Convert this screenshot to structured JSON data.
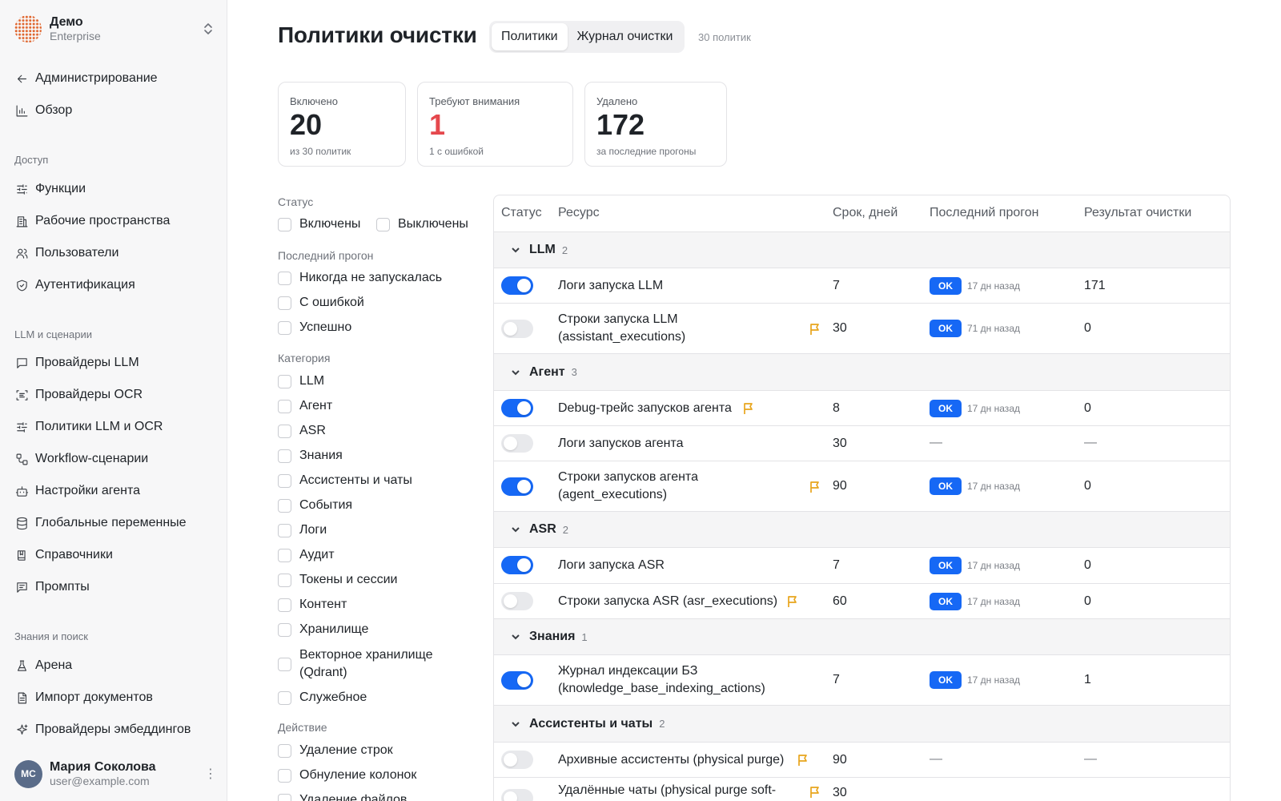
{
  "org": {
    "name": "Демо",
    "plan": "Enterprise"
  },
  "nav": {
    "back": "Администрирование",
    "overview": "Обзор",
    "sections": {
      "access": "Доступ",
      "llm": "LLM и сценарии",
      "knowledge": "Знания и поиск"
    },
    "access_items": [
      "Функции",
      "Рабочие пространства",
      "Пользователи",
      "Аутентификация"
    ],
    "llm_items": [
      "Провайдеры LLM",
      "Провайдеры OCR",
      "Политики LLM и OCR",
      "Workflow-сценарии",
      "Настройки агента",
      "Глобальные переменные",
      "Справочники",
      "Промпты"
    ],
    "knowledge_items": [
      "Арена",
      "Импорт документов",
      "Провайдеры эмбеддингов"
    ]
  },
  "user": {
    "initials": "МС",
    "name": "Мария Соколова",
    "email": "user@example.com"
  },
  "header": {
    "title": "Политики очистки",
    "tabs": [
      "Политики",
      "Журнал очистки"
    ],
    "count": "30 политик"
  },
  "kpis": [
    {
      "label": "Включено",
      "value": "20",
      "sub": "из 30 политик"
    },
    {
      "label": "Требуют внимания",
      "value": "1",
      "sub": "1 с ошибкой"
    },
    {
      "label": "Удалено",
      "value": "172",
      "sub": "за последние прогоны"
    }
  ],
  "filters": {
    "status": {
      "title": "Статус",
      "options": [
        "Включены",
        "Выключены"
      ]
    },
    "last_run": {
      "title": "Последний прогон",
      "options": [
        "Никогда не запускалась",
        "С ошибкой",
        "Успешно"
      ]
    },
    "category": {
      "title": "Категория",
      "options": [
        "LLM",
        "Агент",
        "ASR",
        "Знания",
        "Ассистенты и чаты",
        "События",
        "Логи",
        "Аудит",
        "Токены и сессии",
        "Контент",
        "Хранилище",
        "Векторное хранилище (Qdrant)",
        "Служебное"
      ]
    },
    "action": {
      "title": "Действие",
      "options": [
        "Удаление строк",
        "Обнуление колонок",
        "Удаление файлов"
      ]
    }
  },
  "table": {
    "columns": [
      "Статус",
      "Ресурс",
      "Срок, дней",
      "Последний прогон",
      "Результат очистки"
    ],
    "ok_label": "OK",
    "dash": "—",
    "groups": [
      {
        "name": "LLM",
        "count": "2",
        "rows": [
          {
            "enabled": true,
            "resource": "Логи запуска LLM",
            "flag": false,
            "term": "7",
            "ok": true,
            "ago": "17 дн назад",
            "result": "171"
          },
          {
            "enabled": false,
            "resource": "Строки запуска LLM (assistant_executions)",
            "flag": true,
            "term": "30",
            "ok": true,
            "ago": "71 дн назад",
            "result": "0"
          }
        ]
      },
      {
        "name": "Агент",
        "count": "3",
        "rows": [
          {
            "enabled": true,
            "resource": "Debug-трейс запусков агента",
            "flag": true,
            "term": "8",
            "ok": true,
            "ago": "17 дн назад",
            "result": "0"
          },
          {
            "enabled": false,
            "resource": "Логи запусков агента",
            "flag": false,
            "term": "30",
            "ok": false,
            "ago": "",
            "result": ""
          },
          {
            "enabled": true,
            "resource": "Строки запусков агента (agent_executions)",
            "flag": true,
            "term": "90",
            "ok": true,
            "ago": "17 дн назад",
            "result": "0"
          }
        ]
      },
      {
        "name": "ASR",
        "count": "2",
        "rows": [
          {
            "enabled": true,
            "resource": "Логи запуска ASR",
            "flag": false,
            "term": "7",
            "ok": true,
            "ago": "17 дн назад",
            "result": "0"
          },
          {
            "enabled": false,
            "resource": "Строки запуска ASR (asr_executions)",
            "flag": true,
            "term": "60",
            "ok": true,
            "ago": "17 дн назад",
            "result": "0"
          }
        ]
      },
      {
        "name": "Знания",
        "count": "1",
        "rows": [
          {
            "enabled": true,
            "resource": "Журнал индексации БЗ (knowledge_base_indexing_actions)",
            "flag": false,
            "term": "7",
            "ok": true,
            "ago": "17 дн назад",
            "result": "1"
          }
        ]
      },
      {
        "name": "Ассистенты и чаты",
        "count": "2",
        "rows": [
          {
            "enabled": false,
            "resource": "Архивные ассистенты (physical purge)",
            "flag": true,
            "term": "90",
            "ok": false,
            "ago": "",
            "result": ""
          },
          {
            "enabled": false,
            "resource": "Удалённые чаты (physical purge soft-deleted)",
            "flag": true,
            "term": "30",
            "ok": false,
            "ago": "",
            "result": ""
          }
        ]
      }
    ]
  },
  "colors": {
    "accent": "#1668f5",
    "danger": "#e5484d",
    "flag": "#e8a51c",
    "brand": "#e0662f"
  }
}
